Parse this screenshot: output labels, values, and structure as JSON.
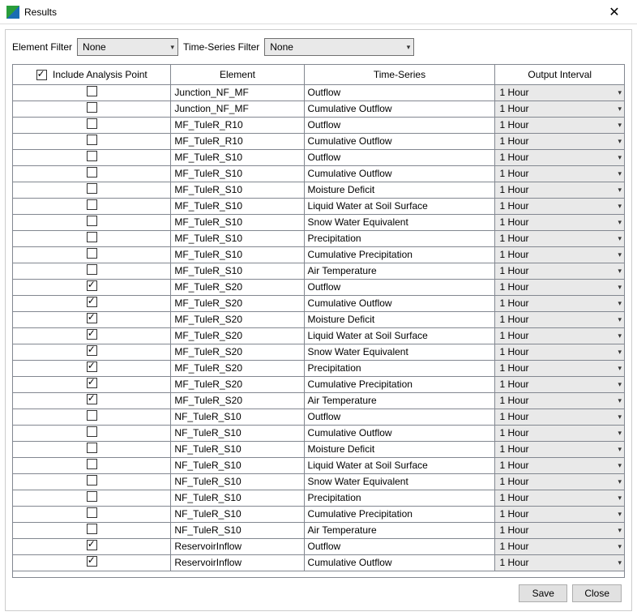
{
  "window": {
    "title": "Results"
  },
  "filters": {
    "element_label": "Element Filter",
    "element_value": "None",
    "timeseries_label": "Time-Series Filter",
    "timeseries_value": "None"
  },
  "table": {
    "headers": {
      "include": "Include Analysis Point",
      "element": "Element",
      "timeseries": "Time-Series",
      "output": "Output Interval"
    },
    "rows": [
      {
        "checked": false,
        "element": "Junction_NF_MF",
        "timeseries": "Outflow",
        "output": "1 Hour"
      },
      {
        "checked": false,
        "element": "Junction_NF_MF",
        "timeseries": "Cumulative Outflow",
        "output": "1 Hour"
      },
      {
        "checked": false,
        "element": "MF_TuleR_R10",
        "timeseries": "Outflow",
        "output": "1 Hour"
      },
      {
        "checked": false,
        "element": "MF_TuleR_R10",
        "timeseries": "Cumulative Outflow",
        "output": "1 Hour"
      },
      {
        "checked": false,
        "element": "MF_TuleR_S10",
        "timeseries": "Outflow",
        "output": "1 Hour"
      },
      {
        "checked": false,
        "element": "MF_TuleR_S10",
        "timeseries": "Cumulative Outflow",
        "output": "1 Hour"
      },
      {
        "checked": false,
        "element": "MF_TuleR_S10",
        "timeseries": "Moisture Deficit",
        "output": "1 Hour"
      },
      {
        "checked": false,
        "element": "MF_TuleR_S10",
        "timeseries": "Liquid Water at Soil Surface",
        "output": "1 Hour"
      },
      {
        "checked": false,
        "element": "MF_TuleR_S10",
        "timeseries": "Snow Water Equivalent",
        "output": "1 Hour"
      },
      {
        "checked": false,
        "element": "MF_TuleR_S10",
        "timeseries": "Precipitation",
        "output": "1 Hour"
      },
      {
        "checked": false,
        "element": "MF_TuleR_S10",
        "timeseries": "Cumulative Precipitation",
        "output": "1 Hour"
      },
      {
        "checked": false,
        "element": "MF_TuleR_S10",
        "timeseries": "Air Temperature",
        "output": "1 Hour"
      },
      {
        "checked": true,
        "element": "MF_TuleR_S20",
        "timeseries": "Outflow",
        "output": "1 Hour"
      },
      {
        "checked": true,
        "element": "MF_TuleR_S20",
        "timeseries": "Cumulative Outflow",
        "output": "1 Hour"
      },
      {
        "checked": true,
        "element": "MF_TuleR_S20",
        "timeseries": "Moisture Deficit",
        "output": "1 Hour"
      },
      {
        "checked": true,
        "element": "MF_TuleR_S20",
        "timeseries": "Liquid Water at Soil Surface",
        "output": "1 Hour"
      },
      {
        "checked": true,
        "element": "MF_TuleR_S20",
        "timeseries": "Snow Water Equivalent",
        "output": "1 Hour"
      },
      {
        "checked": true,
        "element": "MF_TuleR_S20",
        "timeseries": "Precipitation",
        "output": "1 Hour"
      },
      {
        "checked": true,
        "element": "MF_TuleR_S20",
        "timeseries": "Cumulative Precipitation",
        "output": "1 Hour"
      },
      {
        "checked": true,
        "element": "MF_TuleR_S20",
        "timeseries": "Air Temperature",
        "output": "1 Hour"
      },
      {
        "checked": false,
        "element": "NF_TuleR_S10",
        "timeseries": "Outflow",
        "output": "1 Hour"
      },
      {
        "checked": false,
        "element": "NF_TuleR_S10",
        "timeseries": "Cumulative Outflow",
        "output": "1 Hour"
      },
      {
        "checked": false,
        "element": "NF_TuleR_S10",
        "timeseries": "Moisture Deficit",
        "output": "1 Hour"
      },
      {
        "checked": false,
        "element": "NF_TuleR_S10",
        "timeseries": "Liquid Water at Soil Surface",
        "output": "1 Hour"
      },
      {
        "checked": false,
        "element": "NF_TuleR_S10",
        "timeseries": "Snow Water Equivalent",
        "output": "1 Hour"
      },
      {
        "checked": false,
        "element": "NF_TuleR_S10",
        "timeseries": "Precipitation",
        "output": "1 Hour"
      },
      {
        "checked": false,
        "element": "NF_TuleR_S10",
        "timeseries": "Cumulative Precipitation",
        "output": "1 Hour"
      },
      {
        "checked": false,
        "element": "NF_TuleR_S10",
        "timeseries": "Air Temperature",
        "output": "1 Hour"
      },
      {
        "checked": true,
        "element": "ReservoirInflow",
        "timeseries": "Outflow",
        "output": "1 Hour"
      },
      {
        "checked": true,
        "element": "ReservoirInflow",
        "timeseries": "Cumulative Outflow",
        "output": "1 Hour"
      }
    ]
  },
  "buttons": {
    "save": "Save",
    "close": "Close"
  }
}
